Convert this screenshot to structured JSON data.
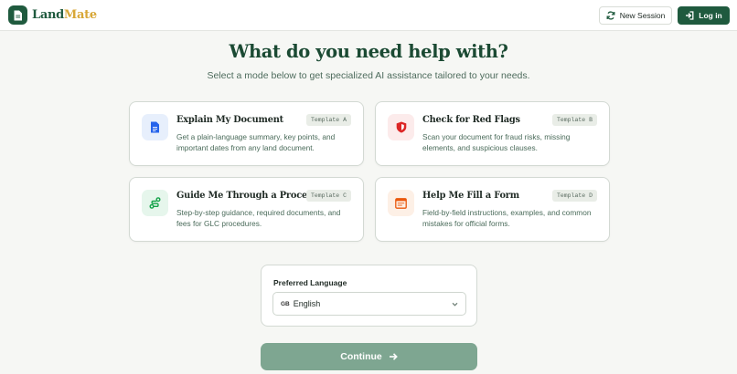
{
  "header": {
    "logo_part1": "Land",
    "logo_part2": "Mate",
    "new_session_label": "New Session",
    "login_label": "Log in"
  },
  "hero": {
    "title": "What do you need help with?",
    "subtitle": "Select a mode below to get specialized AI assistance tailored to your needs."
  },
  "cards": [
    {
      "title": "Explain My Document",
      "tag": "Template A",
      "description": "Get a plain-language summary, key points, and important dates from any land document.",
      "icon": "document-icon",
      "accent": "#2563eb"
    },
    {
      "title": "Check for Red Flags",
      "tag": "Template B",
      "description": "Scan your document for fraud risks, missing elements, and suspicious clauses.",
      "icon": "shield-icon",
      "accent": "#dc2626"
    },
    {
      "title": "Guide Me Through a Process",
      "tag": "Template C",
      "description": "Step-by-step guidance, required documents, and fees for GLC procedures.",
      "icon": "route-icon",
      "accent": "#16a34a"
    },
    {
      "title": "Help Me Fill a Form",
      "tag": "Template D",
      "description": "Field-by-field instructions, examples, and common mistakes for official forms.",
      "icon": "form-icon",
      "accent": "#ea580c"
    }
  ],
  "language": {
    "label": "Preferred Language",
    "flag": "GB",
    "selected": "English"
  },
  "continue_label": "Continue",
  "colors": {
    "brand": "#1f5a3e",
    "brand_accent": "#d8a737",
    "continue_disabled": "#7ea691"
  }
}
